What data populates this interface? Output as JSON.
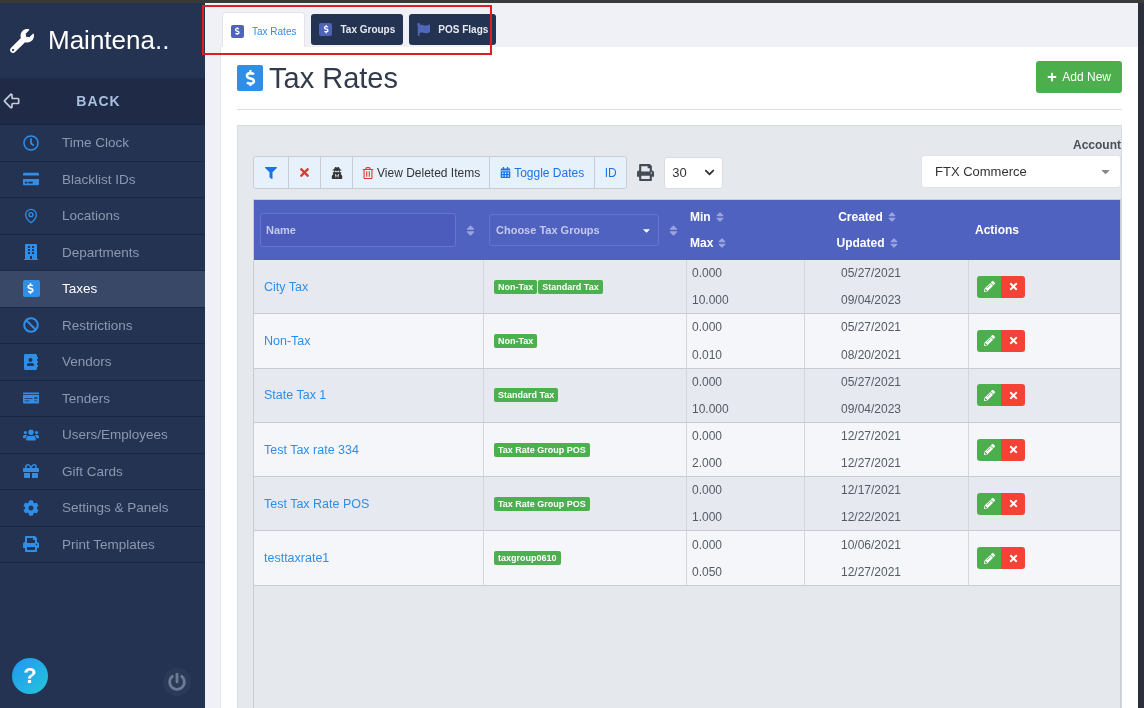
{
  "sidebar": {
    "title": "Maintena..",
    "back": "BACK",
    "items": [
      {
        "label": "Time Clock",
        "selected": false
      },
      {
        "label": "Blacklist IDs",
        "selected": false
      },
      {
        "label": "Locations",
        "selected": false
      },
      {
        "label": "Departments",
        "selected": false
      },
      {
        "label": "Taxes",
        "selected": true
      },
      {
        "label": "Restrictions",
        "selected": false
      },
      {
        "label": "Vendors",
        "selected": false
      },
      {
        "label": "Tenders",
        "selected": false
      },
      {
        "label": "Users/Employees",
        "selected": false
      },
      {
        "label": "Gift Cards",
        "selected": false
      },
      {
        "label": "Settings & Panels",
        "selected": false
      },
      {
        "label": "Print Templates",
        "selected": false
      }
    ],
    "help": "?"
  },
  "tabs": [
    {
      "label": "Tax Rates",
      "selected": true
    },
    {
      "label": "Tax Groups",
      "selected": false
    },
    {
      "label": "POS Flags",
      "selected": false
    }
  ],
  "page": {
    "title": "Tax Rates",
    "add_button": "Add New"
  },
  "toolbar": {
    "view_deleted": "View Deleted Items",
    "toggle_dates": "Toggle Dates",
    "id": "ID",
    "page_size": "30"
  },
  "account": {
    "label": "Account",
    "value": "FTX Commerce"
  },
  "table": {
    "columns": {
      "name_placeholder": "Name",
      "groups_placeholder": "Choose Tax Groups",
      "min": "Min",
      "max": "Max",
      "created": "Created",
      "updated": "Updated",
      "actions": "Actions"
    },
    "rows": [
      {
        "name": "City Tax",
        "groups": [
          "Non-Tax",
          "Standard Tax"
        ],
        "min": "0.000",
        "max": "10.000",
        "created": "05/27/2021",
        "updated": "09/04/2023"
      },
      {
        "name": "Non-Tax",
        "groups": [
          "Non-Tax"
        ],
        "min": "0.000",
        "max": "0.010",
        "created": "05/27/2021",
        "updated": "08/20/2021"
      },
      {
        "name": "State Tax 1",
        "groups": [
          "Standard Tax"
        ],
        "min": "0.000",
        "max": "10.000",
        "created": "05/27/2021",
        "updated": "09/04/2023"
      },
      {
        "name": "Test Tax rate 334",
        "groups": [
          "Tax Rate Group POS"
        ],
        "min": "0.000",
        "max": "2.000",
        "created": "12/27/2021",
        "updated": "12/27/2021"
      },
      {
        "name": "Test Tax Rate POS",
        "groups": [
          "Tax Rate Group POS"
        ],
        "min": "0.000",
        "max": "1.000",
        "created": "12/17/2021",
        "updated": "12/22/2021"
      },
      {
        "name": "testtaxrate1",
        "groups": [
          "taxgroup0610"
        ],
        "min": "0.000",
        "max": "0.050",
        "created": "10/06/2021",
        "updated": "12/27/2021"
      }
    ]
  }
}
